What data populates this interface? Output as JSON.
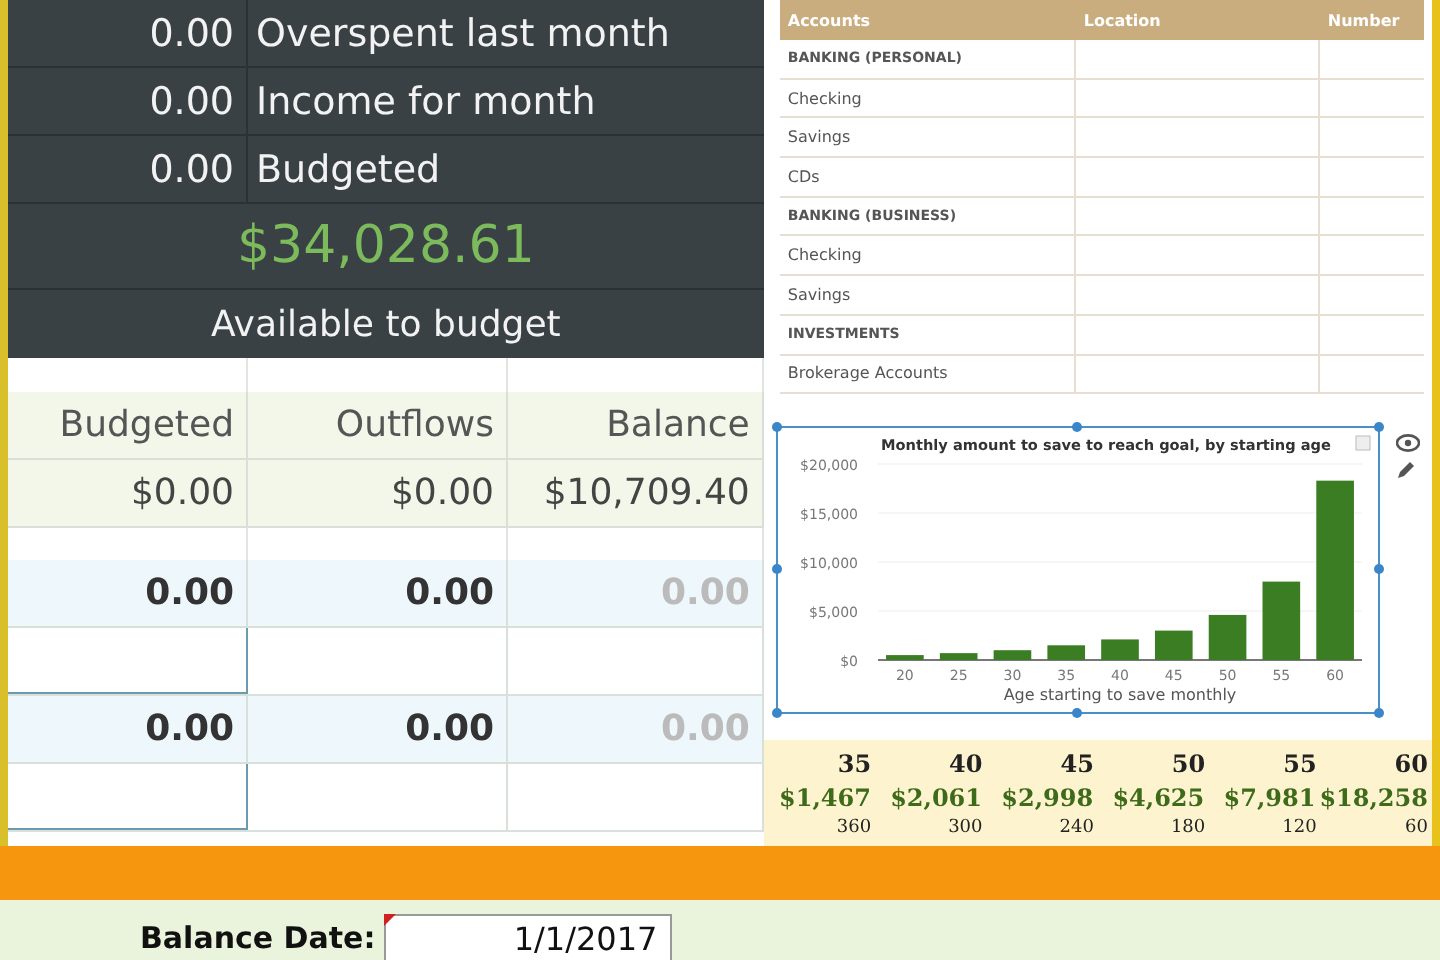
{
  "summary": {
    "rows": [
      {
        "amount": "0.00",
        "label": "Overspent last month"
      },
      {
        "amount": "0.00",
        "label": "Income for month"
      },
      {
        "amount": "0.00",
        "label": "Budgeted"
      }
    ],
    "available_amount": "$34,028.61",
    "available_label": "Available to budget"
  },
  "budget_table": {
    "columns": [
      "Budgeted",
      "Outflows",
      "Balance"
    ],
    "totals": [
      "$0.00",
      "$0.00",
      "$10,709.40"
    ],
    "rows": [
      {
        "cells": [
          "0.00",
          "0.00",
          "0.00"
        ]
      },
      {
        "cells": [
          "0.00",
          "0.00",
          "0.00"
        ]
      }
    ]
  },
  "accounts_table": {
    "columns": [
      "Accounts",
      "Location",
      "Number"
    ],
    "rows": [
      {
        "label": "BANKING (PERSONAL)",
        "kind": "heading"
      },
      {
        "label": "Checking",
        "kind": "item"
      },
      {
        "label": "Savings",
        "kind": "item"
      },
      {
        "label": "CDs",
        "kind": "item"
      },
      {
        "label": "BANKING (BUSINESS)",
        "kind": "heading"
      },
      {
        "label": "Checking",
        "kind": "item"
      },
      {
        "label": "Savings",
        "kind": "item"
      },
      {
        "label": "INVESTMENTS",
        "kind": "heading"
      },
      {
        "label": "Brokerage Accounts",
        "kind": "item"
      }
    ]
  },
  "chart": {
    "chart_data": {
      "type": "bar",
      "title": "Monthly amount to save to reach goal, by starting age",
      "xlabel": "Age starting to save monthly",
      "categories": [
        "20",
        "25",
        "30",
        "35",
        "40",
        "45",
        "50",
        "55",
        "60"
      ],
      "values": [
        500,
        700,
        1000,
        1500,
        2100,
        3000,
        4600,
        8000,
        18300
      ],
      "grid": true,
      "ylim": [
        0,
        20000
      ],
      "yticks": [
        {
          "value": 0,
          "label": "$0"
        },
        {
          "value": 5000,
          "label": "$5,000"
        },
        {
          "value": 10000,
          "label": "$10,000"
        },
        {
          "value": 15000,
          "label": "$15,000"
        },
        {
          "value": 20000,
          "label": "$20,000"
        }
      ]
    }
  },
  "savings_table": {
    "ages": [
      "35",
      "40",
      "45",
      "50",
      "55",
      "60"
    ],
    "amounts": [
      "$1,467",
      "$2,061",
      "$2,998",
      "$4,625",
      "$7,981",
      "$18,258"
    ],
    "months": [
      "360",
      "300",
      "240",
      "180",
      "120",
      "60"
    ]
  },
  "balance_date": {
    "label": "Balance Date:",
    "value": "1/1/2017"
  }
}
